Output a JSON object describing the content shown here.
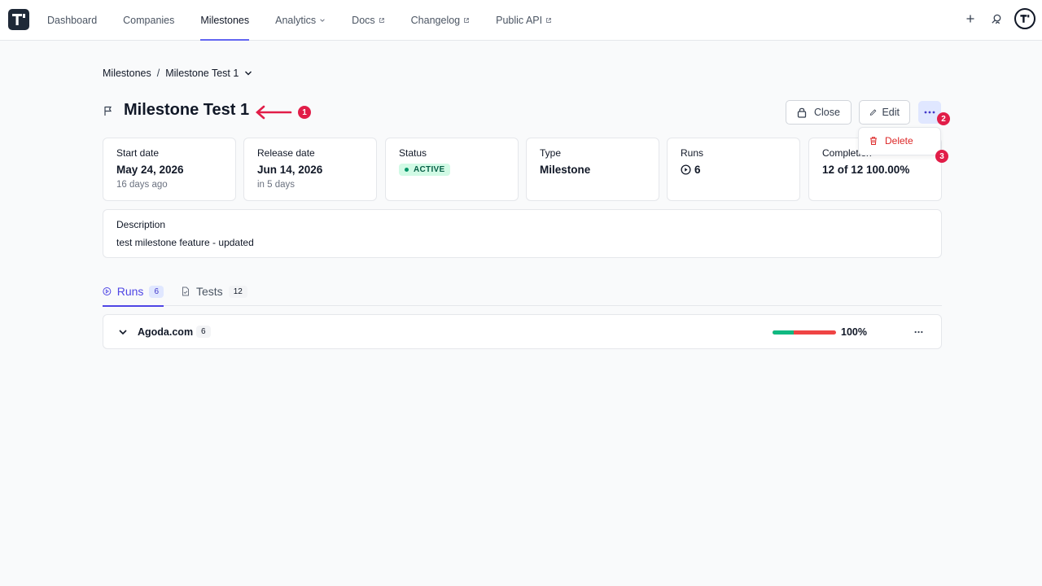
{
  "nav": {
    "items": [
      {
        "label": "Dashboard",
        "active": false,
        "external": false,
        "dropdown": false
      },
      {
        "label": "Companies",
        "active": false,
        "external": false,
        "dropdown": false
      },
      {
        "label": "Milestones",
        "active": true,
        "external": false,
        "dropdown": false
      },
      {
        "label": "Analytics",
        "active": false,
        "external": false,
        "dropdown": true
      },
      {
        "label": "Docs",
        "active": false,
        "external": true,
        "dropdown": false
      },
      {
        "label": "Changelog",
        "active": false,
        "external": true,
        "dropdown": false
      },
      {
        "label": "Public API",
        "active": false,
        "external": true,
        "dropdown": false
      }
    ],
    "right_icons": [
      "plus-icon",
      "search-user-icon",
      "avatar-icon"
    ]
  },
  "breadcrumb": {
    "root": "Milestones",
    "separator": "/",
    "current": "Milestone Test 1"
  },
  "header": {
    "title": "Milestone Test 1",
    "icon": "flag-icon"
  },
  "annotations": {
    "one": "1",
    "two": "2",
    "three": "3"
  },
  "actions": {
    "close_label": "Close",
    "edit_label": "Edit",
    "menu": {
      "delete_label": "Delete"
    }
  },
  "stats": {
    "start": {
      "label": "Start date",
      "value": "May 24, 2026",
      "sub": "16 days ago"
    },
    "release": {
      "label": "Release date",
      "value": "Jun 14, 2026",
      "sub": "in 5 days"
    },
    "status": {
      "label": "Status",
      "value": "ACTIVE"
    },
    "type": {
      "label": "Type",
      "value": "Milestone"
    },
    "runs": {
      "label": "Runs",
      "value": "6"
    },
    "completion": {
      "label": "Completion",
      "value": "12 of 12 100.00%"
    }
  },
  "description": {
    "label": "Description",
    "text": "test milestone feature - updated"
  },
  "tabs": [
    {
      "label": "Runs",
      "count": "6",
      "active": true
    },
    {
      "label": "Tests",
      "count": "12",
      "active": false
    }
  ],
  "runs": [
    {
      "name": "Agoda.com",
      "count": "6",
      "percent": "100%",
      "pass_fraction": 0.33
    }
  ],
  "colors": {
    "accent": "#4f46e5",
    "annotation": "#e11d48",
    "pass": "#10b981",
    "fail": "#ef4444",
    "active_status": "#d1fae5"
  }
}
